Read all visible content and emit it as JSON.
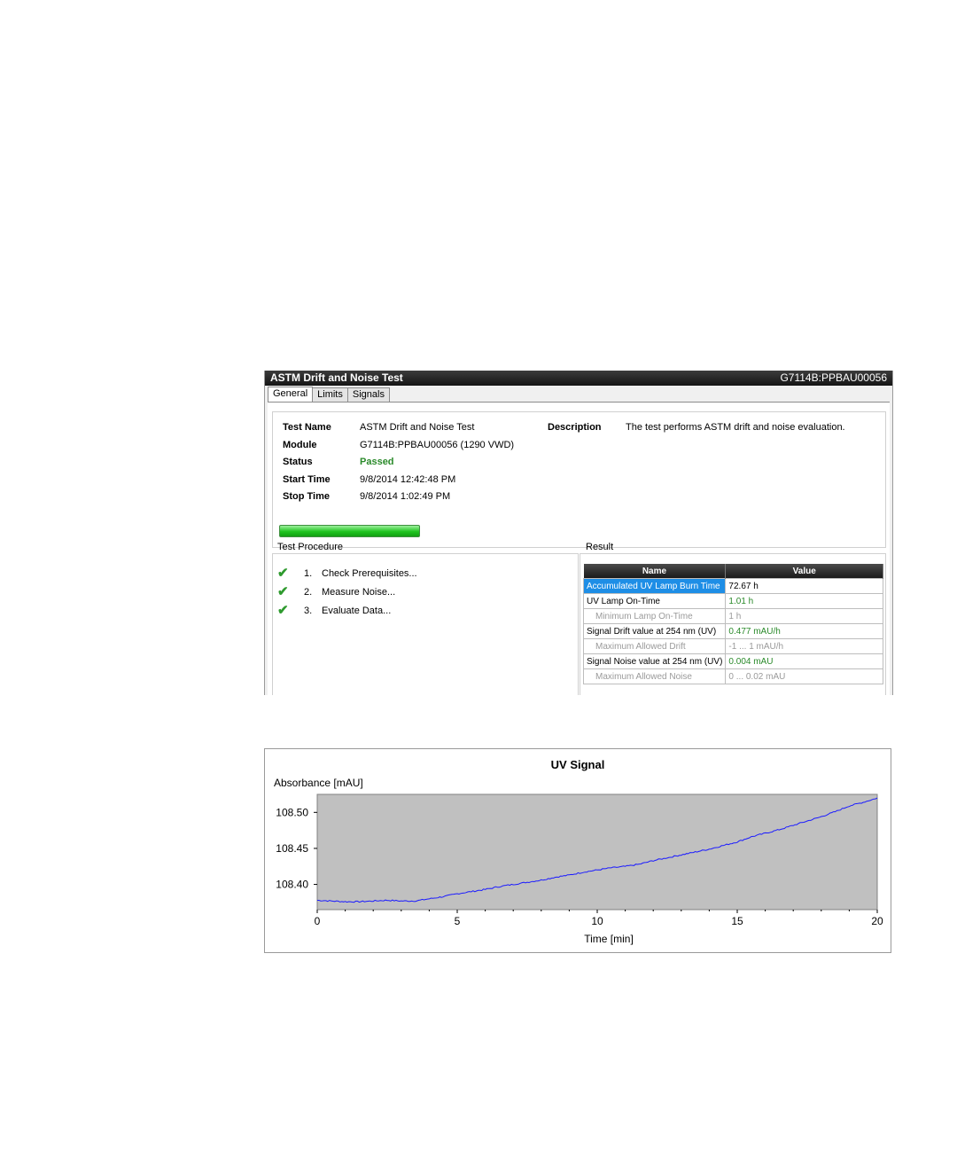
{
  "window": {
    "title": "ASTM Drift and Noise Test",
    "serial": "G7114B:PPBAU00056",
    "tabs": [
      "General",
      "Limits",
      "Signals"
    ]
  },
  "general": {
    "labels": {
      "test_name": "Test Name",
      "module": "Module",
      "status": "Status",
      "start_time": "Start Time",
      "stop_time": "Stop Time",
      "description": "Description"
    },
    "values": {
      "test_name": "ASTM Drift and Noise Test",
      "module": "G7114B:PPBAU00056 (1290 VWD)",
      "status": "Passed",
      "start_time": "9/8/2014 12:42:48 PM",
      "stop_time": "9/8/2014 1:02:49 PM",
      "description": "The test performs ASTM drift and noise evaluation."
    },
    "progress": 1.0,
    "colors": {
      "passed": "#2a8a2a",
      "selected_row": "#1e8ee6"
    }
  },
  "procedure": {
    "title": "Test Procedure",
    "steps": [
      {
        "num": "1.",
        "label": "Check Prerequisites...",
        "icon": "check-icon"
      },
      {
        "num": "2.",
        "label": "Measure Noise...",
        "icon": "check-icon"
      },
      {
        "num": "3.",
        "label": "Evaluate Data...",
        "icon": "check-icon"
      }
    ]
  },
  "result": {
    "title": "Result",
    "headers": [
      "Name",
      "Value"
    ],
    "rows": [
      {
        "name": "Accumulated UV Lamp Burn Time",
        "value": "72.67 h"
      },
      {
        "name": "UV Lamp On-Time",
        "value": "1.01 h"
      },
      {
        "name": "Minimum Lamp On-Time",
        "value": "1 h"
      },
      {
        "name": "Signal Drift value at 254 nm (UV)",
        "value": "0.477 mAU/h"
      },
      {
        "name": "Maximum Allowed Drift",
        "value": "-1 ... 1 mAU/h"
      },
      {
        "name": "Signal Noise value at 254 nm (UV)",
        "value": "0.004 mAU"
      },
      {
        "name": "Maximum Allowed Noise",
        "value": "0 ... 0.02 mAU"
      }
    ]
  },
  "chart_data": {
    "type": "line",
    "title": "UV Signal",
    "xlabel": "Time [min]",
    "ylabel": "Absorbance [mAU]",
    "xlim": [
      0,
      20
    ],
    "ylim": [
      108.365,
      108.525
    ],
    "xticks": [
      "0",
      "5",
      "10",
      "15",
      "20"
    ],
    "yticks": [
      "108.40",
      "108.45",
      "108.50"
    ],
    "grid": false,
    "background": "#c0c0c0",
    "line_color": "#1a1aff",
    "series": [
      {
        "x": [
          0,
          0.5,
          1,
          1.5,
          2,
          2.5,
          3,
          3.5,
          4,
          4.5,
          5,
          5.5,
          6,
          6.5,
          7,
          7.5,
          8,
          8.5,
          9,
          9.5,
          10,
          10.5,
          11,
          11.5,
          12,
          12.5,
          13,
          13.5,
          14,
          14.5,
          15,
          15.5,
          16,
          16.5,
          17,
          17.5,
          18,
          18.5,
          19,
          19.5,
          20
        ],
        "y": [
          108.378,
          108.377,
          108.376,
          108.376,
          108.377,
          108.378,
          108.377,
          108.377,
          108.38,
          108.383,
          108.387,
          108.39,
          108.393,
          108.397,
          108.4,
          108.403,
          108.406,
          108.41,
          108.413,
          108.417,
          108.42,
          108.423,
          108.425,
          108.428,
          108.433,
          108.437,
          108.441,
          108.445,
          108.449,
          108.454,
          108.459,
          108.466,
          108.471,
          108.476,
          108.482,
          108.488,
          108.494,
          108.501,
          108.509,
          108.514,
          108.52
        ]
      }
    ]
  }
}
